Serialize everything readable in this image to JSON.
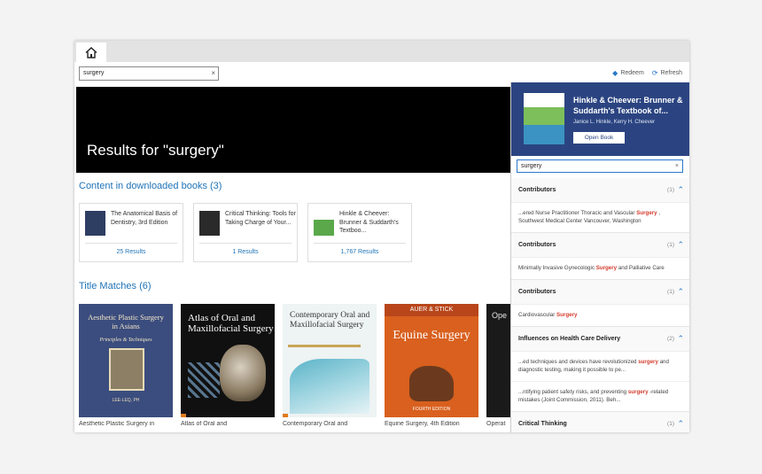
{
  "toolbar": {
    "search_value": "surgery",
    "clear": "×",
    "redeem": "Redeem",
    "refresh": "Refresh"
  },
  "hero": {
    "title": "Results for \"surgery\""
  },
  "content_section": {
    "title": "Content in downloaded books",
    "count": "(3)",
    "cards": [
      {
        "title": "The Anatomical Basis of Dentistry,  3rd Edition",
        "results": "25 Results",
        "thumb_color": "#2e3d62"
      },
      {
        "title": "Critical Thinking: Tools for Taking Charge of Your...",
        "results": "1 Results",
        "thumb_color": "#2a2a2a"
      },
      {
        "title": "Hinkle & Cheever: Brunner & Suddarth's Textboo...",
        "results": "1,767 Results",
        "thumb_color": "#5aa84a"
      }
    ]
  },
  "title_section": {
    "title": "Title Matches",
    "count": "(6)",
    "covers": [
      {
        "cover_title": "Aesthetic Plastic Surgery in Asians",
        "cover_sub": "Principles & Techniques",
        "cover_author": "LEE-LEQ, PH",
        "caption": "Aesthetic Plastic Surgery in"
      },
      {
        "cover_title": "Atlas of Oral and Maxillofacial Surgery",
        "caption": "Atlas of Oral and"
      },
      {
        "cover_title": "Contemporary Oral and Maxillofacial Surgery",
        "caption": "Contemporary Oral and"
      },
      {
        "cover_author": "AUER & STICK",
        "cover_title": "Equine Surgery",
        "cover_edition": "FOURTH EDITION",
        "caption": "Equine Surgery,  4th Edition"
      },
      {
        "cover_title": "Ope",
        "caption": "Operat"
      }
    ]
  },
  "panel": {
    "book_title": "Hinkle & Cheever: Brunner & Suddarth's Textbook of...",
    "authors": "Janice L. Hinkle, Kerry H. Cheever",
    "open_button": "Open Book",
    "search_value": "surgery",
    "clear": "×",
    "groups": [
      {
        "title": "Contributors",
        "count": "(1)",
        "snippets": [
          {
            "pre": "...ered Nurse Practitioner Thoracic and Vascular ",
            "hl": "Surgery",
            "post": " , Southwest Medical Center Vancouver, Washington"
          }
        ]
      },
      {
        "title": "Contributors",
        "count": "(1)",
        "snippets": [
          {
            "pre": "Minimally Invasive Gynecologic ",
            "hl": "Surgery",
            "post": " and Palliative Care"
          }
        ]
      },
      {
        "title": "Contributors",
        "count": "(1)",
        "snippets": [
          {
            "pre": "Cardiovascular ",
            "hl": "Surgery",
            "post": ""
          }
        ]
      },
      {
        "title": "Influences on Health Care Delivery",
        "count": "(2)",
        "snippets": [
          {
            "pre": "...ed techniques and devices have revolutionized ",
            "hl": "surgery",
            "post": " and diagnostic testing, making it possible to pe..."
          },
          {
            "pre": "...ntifying patient safety risks, and preventing ",
            "hl": "surgery",
            "post": " -related mistakes (Joint Commission, 2011). Beh..."
          }
        ]
      },
      {
        "title": "Critical Thinking",
        "count": "(1)",
        "snippets": []
      }
    ]
  }
}
